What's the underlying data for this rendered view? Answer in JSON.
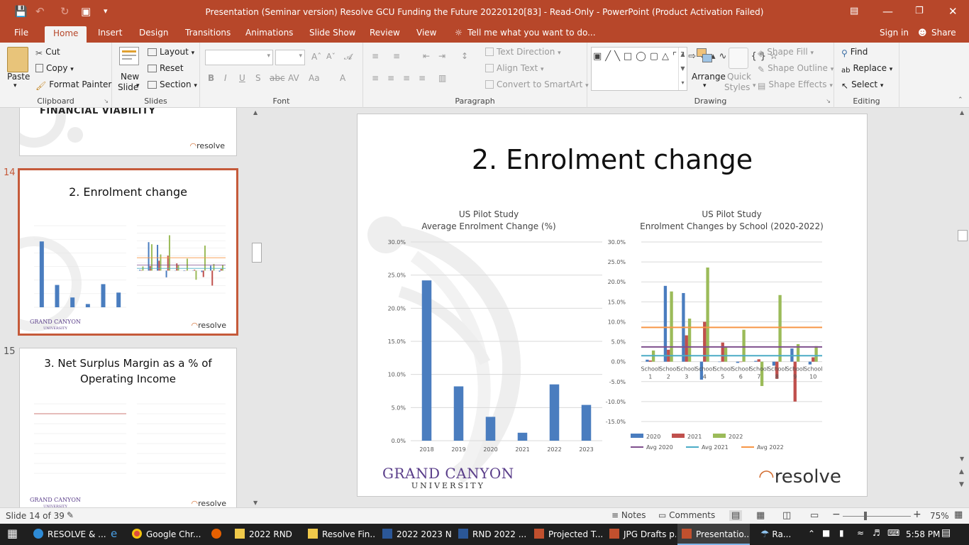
{
  "window": {
    "title": "Presentation (Seminar version) Resolve GCU Funding the Future 20220120[83]  -  Read-Only - PowerPoint (Product Activation Failed)"
  },
  "menu_tabs": [
    "File",
    "Home",
    "Insert",
    "Design",
    "Transitions",
    "Animations",
    "Slide Show",
    "Review",
    "View"
  ],
  "tell_me": "Tell me what you want to do...",
  "signin": "Sign in",
  "share": "Share",
  "ribbon": {
    "clipboard": {
      "paste": "Paste",
      "cut": "Cut",
      "copy": "Copy",
      "format_painter": "Format Painter",
      "label": "Clipboard"
    },
    "slides": {
      "new_slide_1": "New",
      "new_slide_2": "Slide",
      "layout": "Layout",
      "reset": "Reset",
      "section": "Section",
      "label": "Slides"
    },
    "font": {
      "label": "Font"
    },
    "paragraph": {
      "text_direction": "Text Direction",
      "align_text": "Align Text",
      "convert_smartart": "Convert to SmartArt",
      "label": "Paragraph"
    },
    "drawing": {
      "arrange": "Arrange",
      "quick_1": "Quick",
      "quick_2": "Styles",
      "shape_fill": "Shape Fill",
      "shape_outline": "Shape Outline",
      "shape_effects": "Shape Effects",
      "label": "Drawing"
    },
    "editing": {
      "find": "Find",
      "replace": "Replace",
      "select": "Select",
      "label": "Editing"
    }
  },
  "thumbnails": {
    "prev_partial_title": "FINANCIAL VIABILITY",
    "selected": {
      "number": "14",
      "title": "2. Enrolment change"
    },
    "next": {
      "number": "15",
      "title_line1": "3. Net Surplus Margin as a % of",
      "title_line2": "Operating Income"
    },
    "brand_resolve": "resolve",
    "brand_gcu_line1": "GRAND CANYON",
    "brand_gcu_line2": "UNIVERSITY"
  },
  "slide": {
    "title": "2. Enrolment change",
    "gcu_line1": "GRAND CANYON",
    "gcu_line2": "UNIVERSITY",
    "resolve": "resolve"
  },
  "chart_data": [
    {
      "type": "bar",
      "title": "US Pilot Study",
      "subtitle": "Average Enrolment Change (%)",
      "categories": [
        "2018",
        "2019",
        "2020",
        "2021",
        "2022",
        "2023"
      ],
      "values": [
        24.2,
        8.2,
        3.6,
        1.2,
        8.5,
        5.4
      ],
      "yticks": [
        "0.0%",
        "5.0%",
        "10.0%",
        "15.0%",
        "20.0%",
        "25.0%",
        "30.0%"
      ],
      "ylim": [
        0,
        30
      ],
      "color": "#4a7dbf"
    },
    {
      "type": "bar",
      "title": "US Pilot Study",
      "subtitle": "Enrolment Changes by School (2020-2022)",
      "categories": [
        [
          "School",
          "1"
        ],
        [
          "School",
          "2"
        ],
        [
          "School",
          "3"
        ],
        [
          "School",
          "4"
        ],
        [
          "School",
          "5"
        ],
        [
          "School",
          "6"
        ],
        [
          "School",
          "7"
        ],
        [
          "School",
          "8"
        ],
        [
          "School",
          "9"
        ],
        [
          "School",
          "10"
        ]
      ],
      "series": [
        {
          "name": "2020",
          "color": "#4a7dbf",
          "values": [
            0.5,
            19.0,
            17.2,
            -4.5,
            0.0,
            -0.3,
            0.2,
            -1.0,
            3.3,
            -0.7
          ]
        },
        {
          "name": "2021",
          "color": "#c0504d",
          "values": [
            0.3,
            3.0,
            6.6,
            10.0,
            4.8,
            0.0,
            0.6,
            -4.3,
            -10.0,
            1.1
          ]
        },
        {
          "name": "2022",
          "color": "#9bbb59",
          "values": [
            2.8,
            17.6,
            10.8,
            23.6,
            3.6,
            8.0,
            -6.1,
            16.7,
            4.4,
            3.9
          ]
        }
      ],
      "averages": [
        {
          "name": "Avg 2020",
          "color": "#7f4f8e",
          "value": 3.7
        },
        {
          "name": "Avg 2021",
          "color": "#4bacc6",
          "value": 1.5
        },
        {
          "name": "Avg 2022",
          "color": "#f79646",
          "value": 8.6
        }
      ],
      "yticks": [
        "-15.0%",
        "-10.0%",
        "-5.0%",
        "0.0%",
        "5.0%",
        "10.0%",
        "15.0%",
        "20.0%",
        "25.0%",
        "30.0%"
      ],
      "ylim": [
        -15,
        30
      ],
      "legend": "bottom"
    }
  ],
  "status": {
    "slide_info": "Slide 14 of 39",
    "notes": "Notes",
    "comments": "Comments",
    "zoom": "75%"
  },
  "taskbar": {
    "items": [
      "RESOLVE & ...",
      "Google Chr...",
      "2022 RND",
      "Resolve Fin...",
      "2022 2023 N...",
      "RND 2022 ...",
      "Projected T...",
      "JPG Drafts p...",
      "Presentatio..."
    ],
    "weather": "Ra...",
    "clock": "5:58 PM"
  }
}
